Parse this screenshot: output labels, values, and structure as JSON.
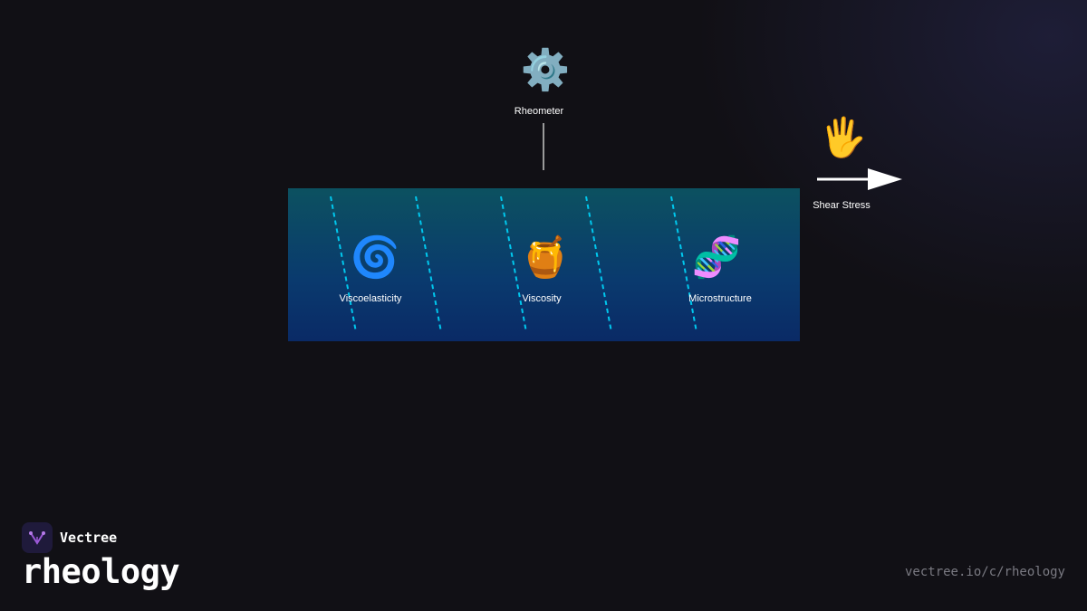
{
  "diagram": {
    "top_tool": {
      "label": "Rheometer",
      "icon": "gear-icon"
    },
    "force": {
      "label": "Shear Stress",
      "icon": "raised-hand-icon"
    },
    "properties": [
      {
        "label": "Viscoelasticity",
        "icon": "cyclone-icon"
      },
      {
        "label": "Viscosity",
        "icon": "honey-pot-icon"
      },
      {
        "label": "Microstructure",
        "icon": "dna-icon"
      }
    ],
    "colors": {
      "block_top": "#0c5160",
      "block_bottom": "#0a2a66",
      "shear_lines": "#00c8ee",
      "arrow": "#ffffff",
      "background": "#111015"
    }
  },
  "footer": {
    "brand": "Vectree",
    "topic": "rheology",
    "url": "vectree.io/c/rheology"
  }
}
